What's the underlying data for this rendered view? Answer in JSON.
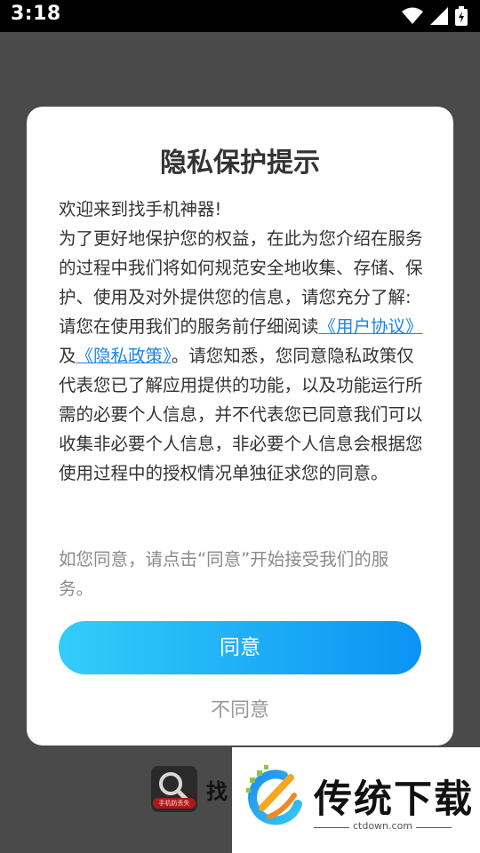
{
  "status_bar": {
    "time": "3:18",
    "icons": [
      "wifi-icon",
      "signal-icon",
      "battery-charging-icon"
    ]
  },
  "background_app": {
    "title": "找",
    "logo_caption": "手机防丢失"
  },
  "dialog": {
    "title": "隐私保护提示",
    "greeting": "欢迎来到找手机神器!",
    "intro": "为了更好地保护您的权益，在此为您介绍在服务的过程中我们将如何规范安全地收集、存储、保护、使用及对外提供您的信息，请您充分了解:",
    "read_prefix": "请您在使用我们的服务前仔细阅读",
    "user_agreement": "《用户协议》",
    "and": "及",
    "privacy_policy": "《隐私政策》",
    "read_suffix": "。请您知悉，您同意隐私政策仅代表您已了解应用提供的功能，以及功能运行所需的必要个人信息，并不代表您已同意我们可以收集非必要个人信息，非必要个人信息会根据您使用过程中的授权情况单独征求您的同意。",
    "note": "如您同意，请点击“同意”开始接受我们的服务。",
    "agree_label": "同意",
    "disagree_label": "不同意"
  },
  "watermark": {
    "title": "传统下载",
    "subtitle": "ctdown.com"
  },
  "colors": {
    "link": "#1a84e6",
    "button_start": "#33cdf9",
    "button_end": "#0b93f4"
  }
}
